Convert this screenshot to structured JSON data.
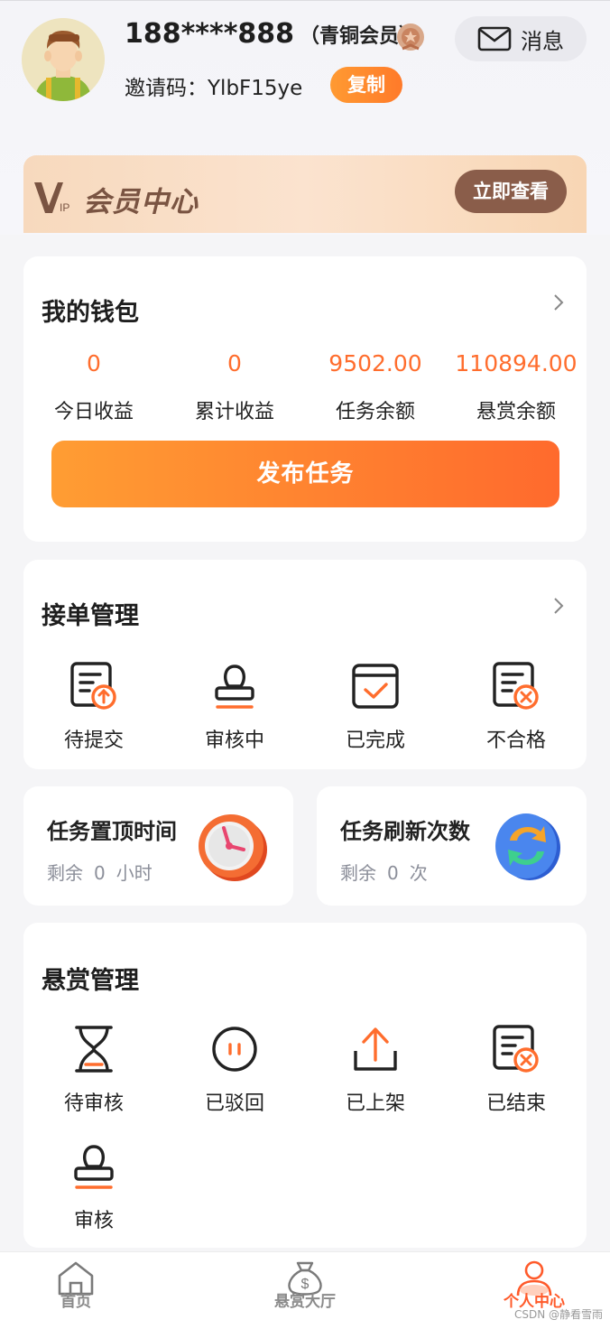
{
  "profile": {
    "phone": "188****888",
    "level": "（青铜会员）",
    "invite_label": "邀请码：",
    "invite_code": "YlbF15ye",
    "copy_label": "复制",
    "message_label": "消息"
  },
  "vip": {
    "logo_text": "VIP",
    "title": "会员中心",
    "button": "立即查看"
  },
  "wallet": {
    "title": "我的钱包",
    "stats": [
      {
        "value": "0",
        "label": "今日收益"
      },
      {
        "value": "0",
        "label": "累计收益"
      },
      {
        "value": "9502.00",
        "label": "任务余额"
      },
      {
        "value": "110894.00",
        "label": "悬赏余额"
      }
    ],
    "publish_button": "发布任务"
  },
  "orders": {
    "title": "接单管理",
    "items": [
      {
        "label": "待提交",
        "icon": "document-upload-icon"
      },
      {
        "label": "审核中",
        "icon": "stamp-icon"
      },
      {
        "label": "已完成",
        "icon": "calendar-check-icon"
      },
      {
        "label": "不合格",
        "icon": "document-reject-icon"
      }
    ]
  },
  "boosts": {
    "top": {
      "title": "任务置顶时间",
      "prefix": "剩余",
      "value": "0",
      "unit": "小时",
      "icon": "alarm-clock-icon"
    },
    "refresh": {
      "title": "任务刷新次数",
      "prefix": "剩余",
      "value": "0",
      "unit": "次",
      "icon": "refresh-icon"
    }
  },
  "rewards": {
    "title": "悬赏管理",
    "items": [
      {
        "label": "待审核",
        "icon": "hourglass-icon"
      },
      {
        "label": "已驳回",
        "icon": "pause-circle-icon"
      },
      {
        "label": "已上架",
        "icon": "upload-icon"
      },
      {
        "label": "已结束",
        "icon": "document-reject-icon"
      },
      {
        "label": "审核",
        "icon": "stamp-icon"
      }
    ]
  },
  "tabbar": [
    {
      "label": "首页",
      "icon": "home-icon",
      "active": false
    },
    {
      "label": "悬赏大厅",
      "icon": "money-bag-icon",
      "active": false
    },
    {
      "label": "个人中心",
      "icon": "user-icon",
      "active": true
    }
  ],
  "watermark": "CSDN @静看雪雨",
  "colors": {
    "accent": "#ff6d2d",
    "vip_brown": "#8a5d4a"
  }
}
